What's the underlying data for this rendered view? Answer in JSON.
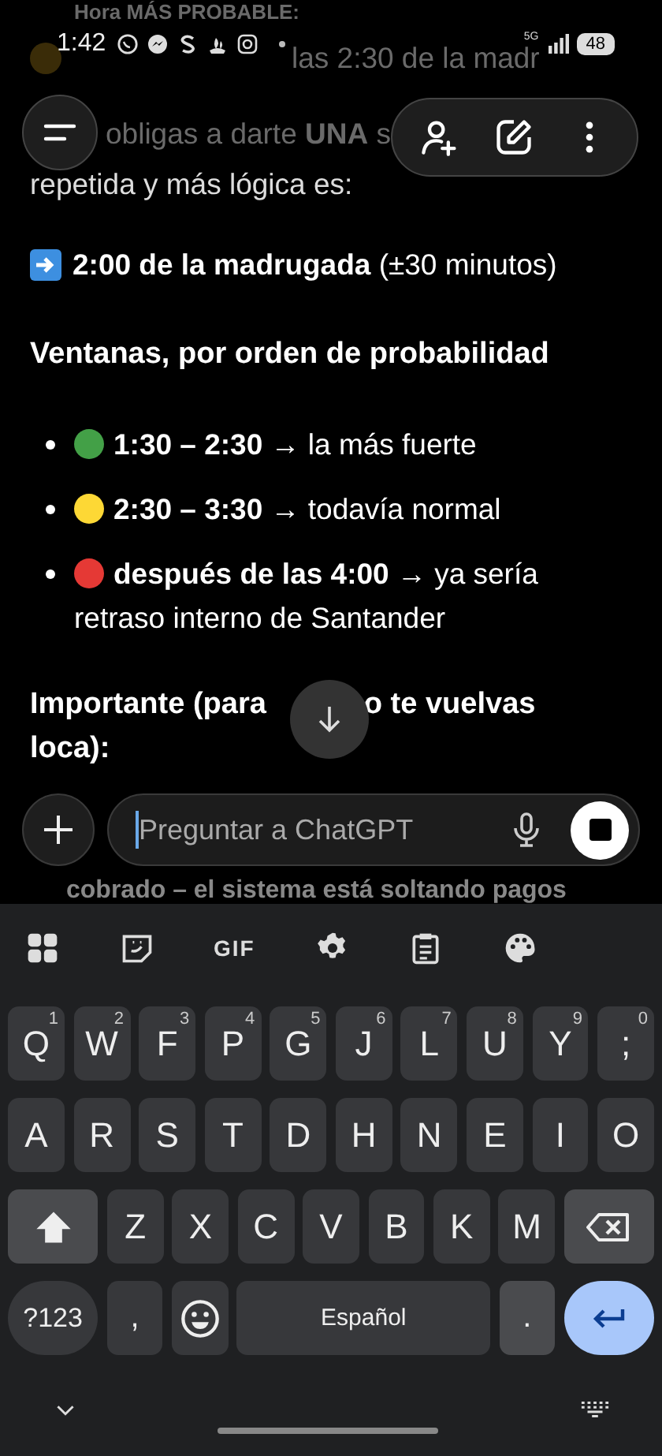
{
  "status_bar": {
    "time": "1:42",
    "network": "5G",
    "battery": "48"
  },
  "chat": {
    "faded_heading": "Hora MÁS PROBABLE:",
    "faded_line": "las 2:30 de la madr",
    "intro_lines": [
      "obligas a darte **UNA** s",
      "repetida y más lógica es:"
    ],
    "answer": "**2:00 de la madrugada** (±30 minutos)",
    "windows_heading": "Ventanas, por orden de probabilidad",
    "windows": [
      {
        "color": "#43a047",
        "text": "**1:30 – 2:30** → la más fuerte"
      },
      {
        "color": "#fdd835",
        "text": "**2:30 – 3:30** → todavía normal"
      },
      {
        "color": "#e53935",
        "text": "**después de las 4:00** → ya sería retraso interno de Santander"
      }
    ],
    "important_heading": {
      "before": "Importante (para",
      "after": "o te vuelvas",
      "line2": "loca):"
    },
    "under_input_line": "cobrado – el sistema está soltando pagos"
  },
  "composer": {
    "placeholder": "Preguntar a ChatGPT"
  },
  "keyboard": {
    "gif": "GIF",
    "rows": [
      [
        {
          "kind": "letter",
          "label": "Q",
          "hint": "1"
        },
        {
          "kind": "letter",
          "label": "W",
          "hint": "2"
        },
        {
          "kind": "letter",
          "label": "F",
          "hint": "3"
        },
        {
          "kind": "letter",
          "label": "P",
          "hint": "4"
        },
        {
          "kind": "letter",
          "label": "G",
          "hint": "5"
        },
        {
          "kind": "letter",
          "label": "J",
          "hint": "6"
        },
        {
          "kind": "letter",
          "label": "L",
          "hint": "7"
        },
        {
          "kind": "letter",
          "label": "U",
          "hint": "8"
        },
        {
          "kind": "letter",
          "label": "Y",
          "hint": "9"
        },
        {
          "kind": "letter",
          "label": ";",
          "hint": "0"
        }
      ],
      [
        {
          "kind": "letter",
          "label": "A"
        },
        {
          "kind": "letter",
          "label": "R"
        },
        {
          "kind": "letter",
          "label": "S"
        },
        {
          "kind": "letter",
          "label": "T"
        },
        {
          "kind": "letter",
          "label": "D"
        },
        {
          "kind": "letter",
          "label": "H"
        },
        {
          "kind": "letter",
          "label": "N"
        },
        {
          "kind": "letter",
          "label": "E"
        },
        {
          "kind": "letter",
          "label": "I"
        },
        {
          "kind": "letter",
          "label": "O"
        }
      ],
      [
        {
          "kind": "shift"
        },
        {
          "kind": "letter",
          "label": "Z"
        },
        {
          "kind": "letter",
          "label": "X"
        },
        {
          "kind": "letter",
          "label": "C"
        },
        {
          "kind": "letter",
          "label": "V"
        },
        {
          "kind": "letter",
          "label": "B"
        },
        {
          "kind": "letter",
          "label": "K"
        },
        {
          "kind": "letter",
          "label": "M"
        },
        {
          "kind": "backspace"
        }
      ]
    ],
    "bottom_keys": {
      "symbols": "?123",
      "comma": ",",
      "space": "Español",
      "period": "."
    }
  }
}
